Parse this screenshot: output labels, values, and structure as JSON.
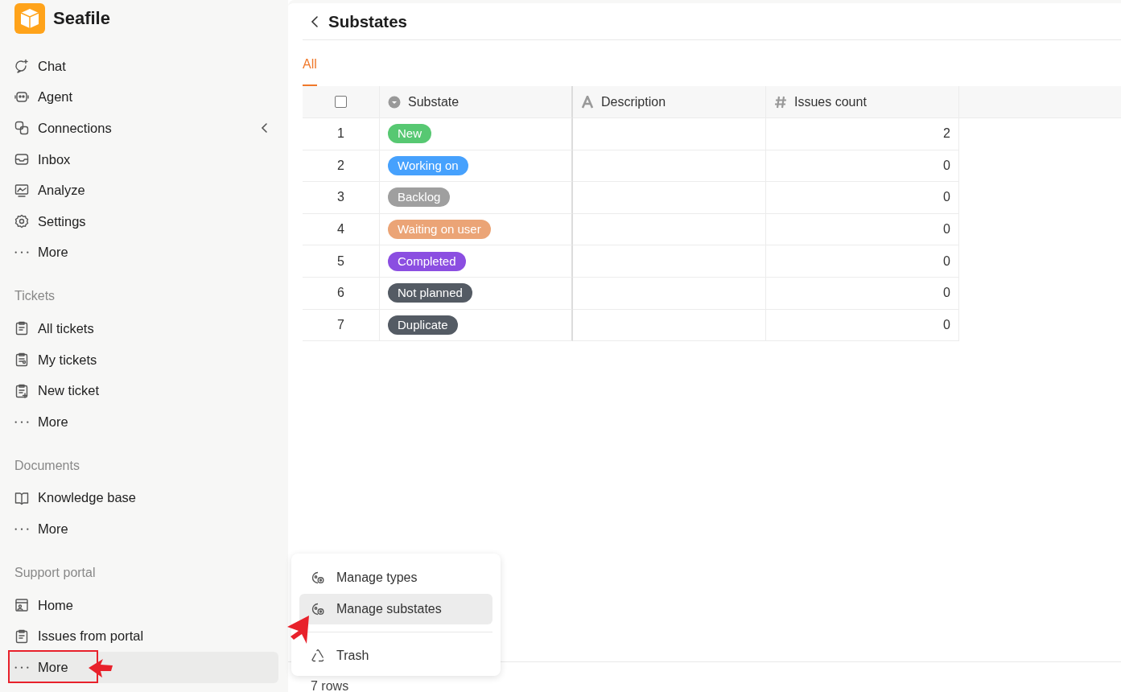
{
  "app": {
    "name": "Seafile"
  },
  "sidebar": {
    "sections": [
      {
        "items": [
          {
            "label": "Chat",
            "selected": false
          },
          {
            "label": "Agent",
            "selected": false
          },
          {
            "label": "Connections",
            "selected": false,
            "expanded": false
          },
          {
            "label": "Inbox",
            "selected": false
          },
          {
            "label": "Analyze",
            "selected": false
          },
          {
            "label": "Settings",
            "selected": false
          },
          {
            "label": "More",
            "selected": false,
            "kind": "more"
          }
        ]
      },
      {
        "title": "Tickets",
        "items": [
          {
            "label": "All tickets",
            "selected": false
          },
          {
            "label": "My tickets",
            "selected": false
          },
          {
            "label": "New ticket",
            "selected": false
          },
          {
            "label": "More",
            "selected": false,
            "kind": "more"
          }
        ]
      },
      {
        "title": "Documents",
        "items": [
          {
            "label": "Knowledge base",
            "selected": false
          },
          {
            "label": "More",
            "selected": false,
            "kind": "more"
          }
        ]
      },
      {
        "title": "Support portal",
        "items": [
          {
            "label": "Home",
            "selected": false
          },
          {
            "label": "Issues from portal",
            "selected": false
          },
          {
            "label": "More",
            "selected": true,
            "kind": "more"
          }
        ]
      }
    ]
  },
  "page": {
    "title": "Substates"
  },
  "tabs": [
    {
      "label": "All",
      "selected": true
    }
  ],
  "table": {
    "select_all": {
      "checked": false
    },
    "columns": [
      {
        "label": "Substate",
        "kind": "select"
      },
      {
        "label": "Description",
        "kind": "text"
      },
      {
        "label": "Issues count",
        "kind": "number"
      }
    ],
    "rows": [
      {
        "number": "1",
        "substate": "New",
        "color": "#57c872",
        "issues_count": "2"
      },
      {
        "number": "2",
        "substate": "Working on",
        "color": "#46a1fd",
        "issues_count": "0"
      },
      {
        "number": "3",
        "substate": "Backlog",
        "color": "#9f9f9f",
        "issues_count": "0"
      },
      {
        "number": "4",
        "substate": "Waiting on user",
        "color": "#eba476",
        "issues_count": "0"
      },
      {
        "number": "5",
        "substate": "Completed",
        "color": "#8b4ee1",
        "issues_count": "0"
      },
      {
        "number": "6",
        "substate": "Not planned",
        "color": "#545b64",
        "issues_count": "0"
      },
      {
        "number": "7",
        "substate": "Duplicate",
        "color": "#545b64",
        "issues_count": "0"
      }
    ]
  },
  "footer": {
    "row_count": "7 rows"
  },
  "menu": {
    "items": [
      {
        "label": "Manage types",
        "selected": false,
        "kind": "manage"
      },
      {
        "label": "Manage substates",
        "selected": true,
        "kind": "manage"
      },
      {
        "label": "Trash",
        "selected": false,
        "kind": "trash"
      }
    ]
  }
}
